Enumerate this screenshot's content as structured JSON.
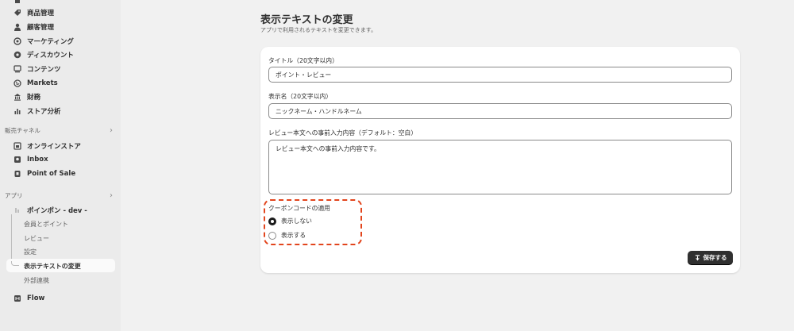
{
  "sidebar": {
    "top_items": [
      {
        "label": "商品管理",
        "icon": "tag-icon"
      },
      {
        "label": "顧客管理",
        "icon": "person-icon"
      },
      {
        "label": "マーケティング",
        "icon": "target-icon"
      },
      {
        "label": "ディスカウント",
        "icon": "discount-icon"
      },
      {
        "label": "コンテンツ",
        "icon": "content-icon"
      },
      {
        "label": "Markets",
        "icon": "globe-icon"
      },
      {
        "label": "財務",
        "icon": "bank-icon"
      },
      {
        "label": "ストア分析",
        "icon": "bar-chart-icon"
      }
    ],
    "sales_channels": {
      "title": "販売チャネル",
      "items": [
        {
          "label": "オンラインストア",
          "icon": "store-icon"
        },
        {
          "label": "Inbox",
          "icon": "inbox-icon"
        },
        {
          "label": "Point of Sale",
          "icon": "pos-icon"
        }
      ]
    },
    "apps": {
      "title": "アプリ",
      "app_name": "ポインポン - dev -",
      "sub_items": [
        "会員とポイント",
        "レビュー",
        "設定",
        "表示テキストの変更",
        "外部連携"
      ],
      "active_sub_item": "表示テキストの変更"
    },
    "flow": {
      "label": "Flow",
      "icon": "flow-icon"
    }
  },
  "page": {
    "title": "表示テキストの変更",
    "subtitle": "アプリで利用されるテキストを変更できます。"
  },
  "form": {
    "title_label": "タイトル（20文字以内）",
    "title_value": "ポイント・レビュー",
    "display_name_label": "表示名（20文字以内）",
    "display_name_value": "ニックネーム・ハンドルネーム",
    "review_prefill_label": "レビュー本文への事前入力内容（デフォルト：空白）",
    "review_prefill_value": "レビュー本文への事前入力内容です。",
    "coupon_label": "クーポンコードの適用",
    "coupon_options": [
      {
        "label": "表示しない",
        "checked": true
      },
      {
        "label": "表示する",
        "checked": false
      }
    ],
    "save_label": "保存する"
  },
  "colors": {
    "highlight": "#e2451d",
    "button": "#303030"
  }
}
